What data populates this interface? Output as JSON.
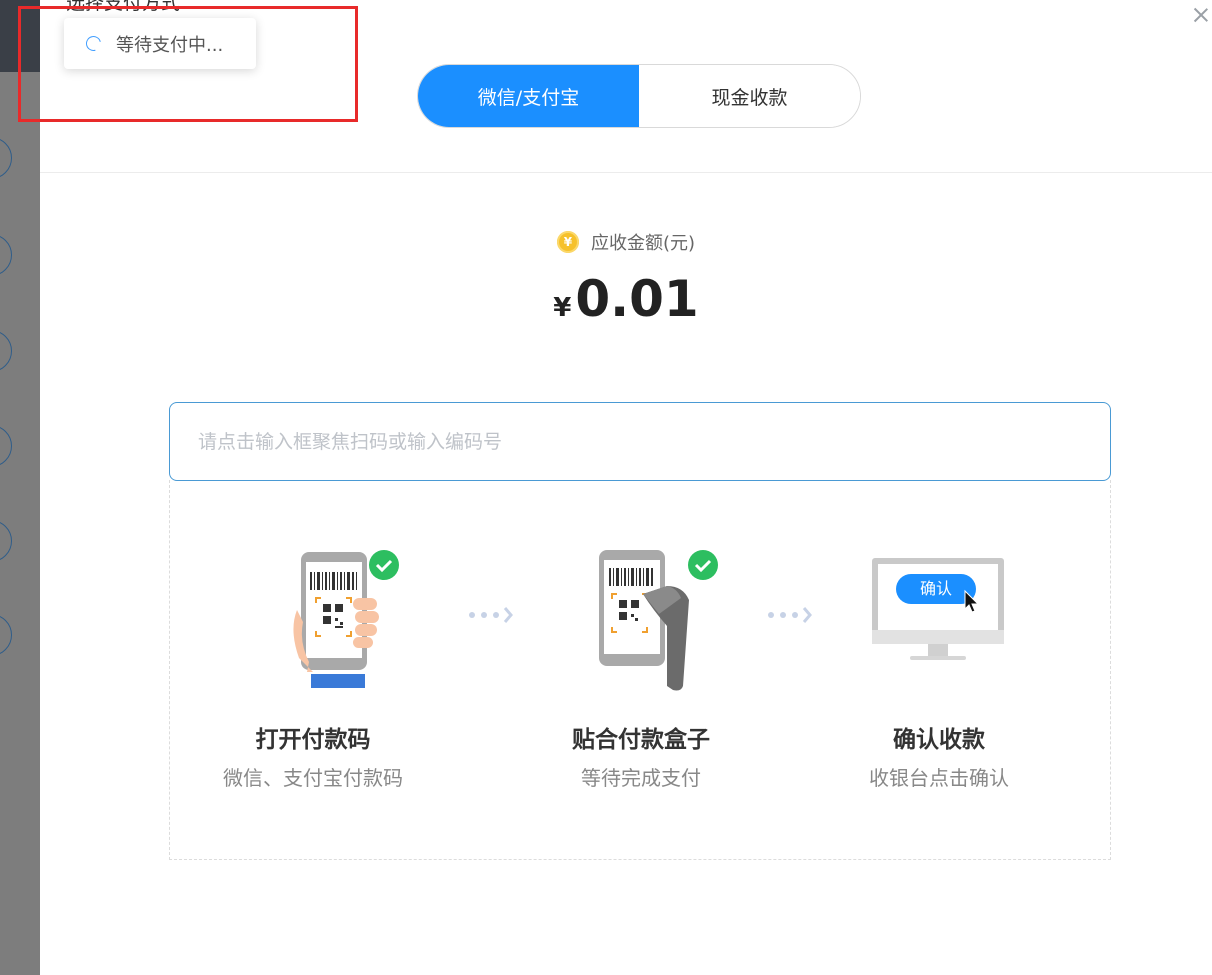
{
  "modal": {
    "title": "选择支付方式",
    "toast_text": "等待支付中..."
  },
  "tabs": [
    {
      "label": "微信/支付宝",
      "active": true
    },
    {
      "label": "现金收款",
      "active": false
    }
  ],
  "amount": {
    "label": "应收金额(元)",
    "coin_symbol": "¥",
    "currency": "¥",
    "value": "0.01"
  },
  "scan": {
    "placeholder": "请点击输入框聚焦扫码或输入编码号",
    "value": ""
  },
  "steps": [
    {
      "title": "打开付款码",
      "subtitle": "微信、支付宝付款码"
    },
    {
      "title": "贴合付款盒子",
      "subtitle": "等待完成支付"
    },
    {
      "title": "确认收款",
      "subtitle": "收银台点击确认",
      "button_label": "确认"
    }
  ],
  "colors": {
    "primary": "#1b8fff",
    "success": "#2dbe60",
    "highlight": "#e82a2a"
  }
}
